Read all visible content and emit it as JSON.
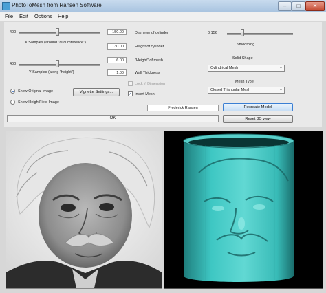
{
  "window": {
    "title": "PhotoToMesh from Ransen Software"
  },
  "menu": [
    "File",
    "Edit",
    "Options",
    "Help"
  ],
  "controls": {
    "x_samples": {
      "slider_value": "400",
      "value": "150.00",
      "label": "X Samples (around \"circumference\")",
      "slider_fraction": 0.45
    },
    "y_samples": {
      "slider_value": "400",
      "value": "130.00",
      "label": "Y Samples (along \"height\")",
      "slider_fraction": 0.45
    },
    "diameter": {
      "label": "Diameter of cylinder"
    },
    "height_cyl": {
      "label": "Height of cylinder"
    },
    "height_mesh": {
      "value": "6.00",
      "label": "\"Height\" of mesh"
    },
    "wall": {
      "value": "1.00",
      "label": "Wall Thickness"
    },
    "lock_y": {
      "label": "Lock Y Dimension",
      "checked": false,
      "disabled": true
    },
    "invert": {
      "label": "Invert Mesh",
      "checked": true
    },
    "smoothing": {
      "value": "0.156",
      "label": "Smoothing",
      "slider_fraction": 0.2
    },
    "solid_shape": {
      "label": "Solid Shape",
      "selected": "Cylindrical Mesh"
    },
    "mesh_type": {
      "label": "Mesh Type",
      "selected": "Closed Triangular Mesh"
    },
    "show_original": {
      "label": "Show Original Image",
      "selected": true
    },
    "show_heightfield": {
      "label": "Show HeightField Image",
      "selected": false
    },
    "vignette_button": "Vignette Settings...",
    "author": "Frederick Ransen",
    "recreate_button": "Recreate Model",
    "reset_button": "Reset 3D view",
    "status": "OK"
  },
  "colors": {
    "mesh": "#3ec7c3",
    "mesh_dark": "#1f7d7c",
    "viewport_bg": "#000000"
  }
}
